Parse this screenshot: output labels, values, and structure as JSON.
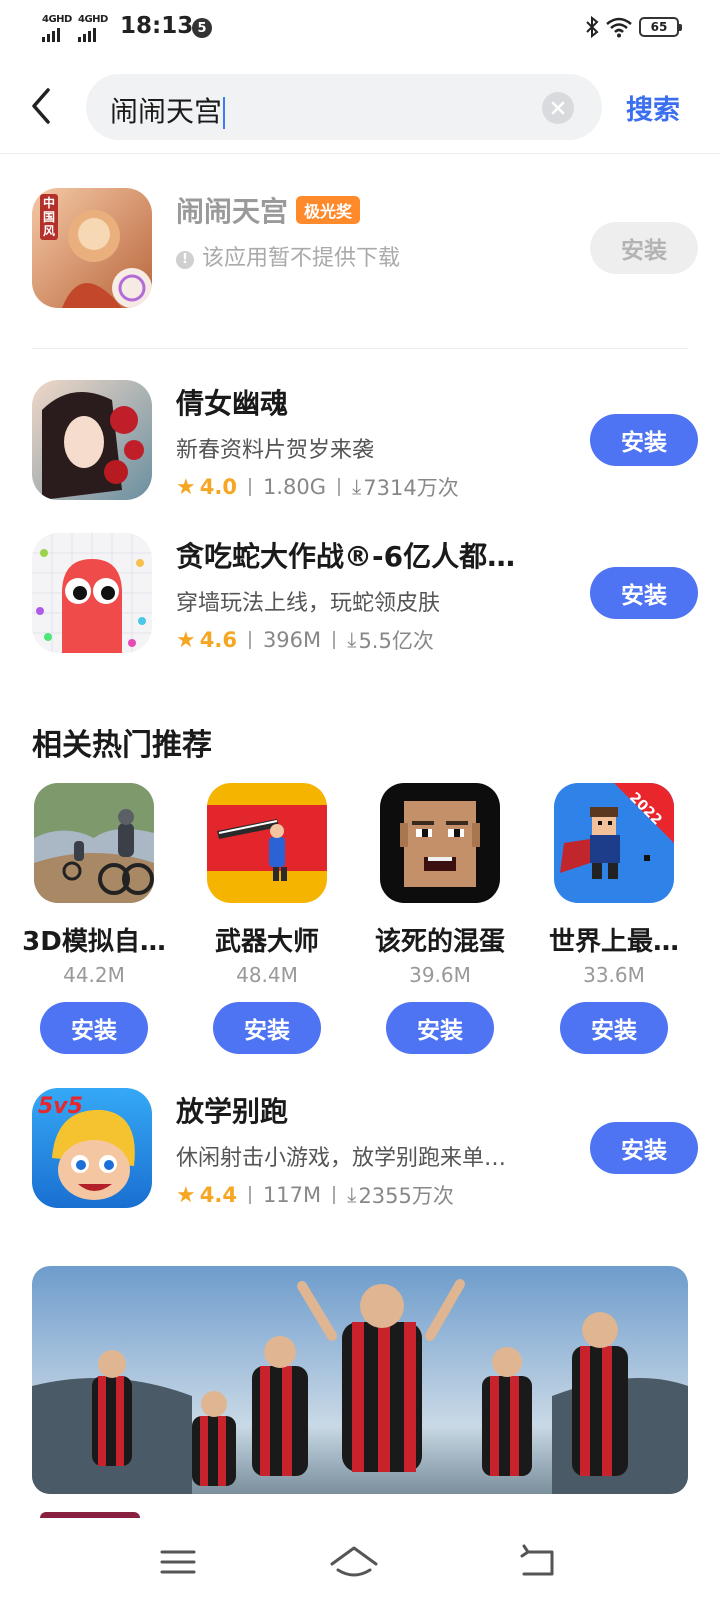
{
  "status_bar": {
    "sim1_label": "4GHD",
    "sim2_label": "4GHD",
    "time": "18:13",
    "notification_count": "5",
    "battery": "65"
  },
  "search": {
    "query": "闹闹天宫",
    "search_button": "搜索"
  },
  "top_result": {
    "title": "闹闹天宫",
    "badge": "极光奖",
    "notice": "该应用暂不提供下载",
    "install_label": "安装"
  },
  "results": [
    {
      "title": "倩女幽魂",
      "desc": "新春资料片贺岁来袭",
      "rating": "4.0",
      "size": "1.80G",
      "downloads": "7314万次",
      "install_label": "安装"
    },
    {
      "title": "贪吃蛇大作战®-6亿人都…",
      "desc": "穿墙玩法上线，玩蛇领皮肤",
      "rating": "4.6",
      "size": "396M",
      "downloads": "5.5亿次",
      "install_label": "安装"
    }
  ],
  "related": {
    "section_title": "相关热门推荐",
    "items": [
      {
        "name": "3D模拟自…",
        "size": "44.2M",
        "install_label": "安装"
      },
      {
        "name": "武器大师",
        "size": "48.4M",
        "install_label": "安装"
      },
      {
        "name": "该死的混蛋",
        "size": "39.6M",
        "install_label": "安装"
      },
      {
        "name": "世界上最…",
        "size": "33.6M",
        "install_label": "安装"
      }
    ]
  },
  "more_result": {
    "title": "放学别跑",
    "desc": "休闲射击小游戏，放学别跑来单…",
    "rating": "4.4",
    "size": "117M",
    "downloads": "2355万次",
    "install_label": "安装",
    "icon_label": "5v5"
  },
  "icon_texts": {
    "game1_label": "中国风",
    "world_game_tag": "2022"
  },
  "colors": {
    "accent": "#4f74f3",
    "search_link": "#3b6ff0",
    "rating": "#f5a623",
    "badge": "#ff8a2b"
  }
}
